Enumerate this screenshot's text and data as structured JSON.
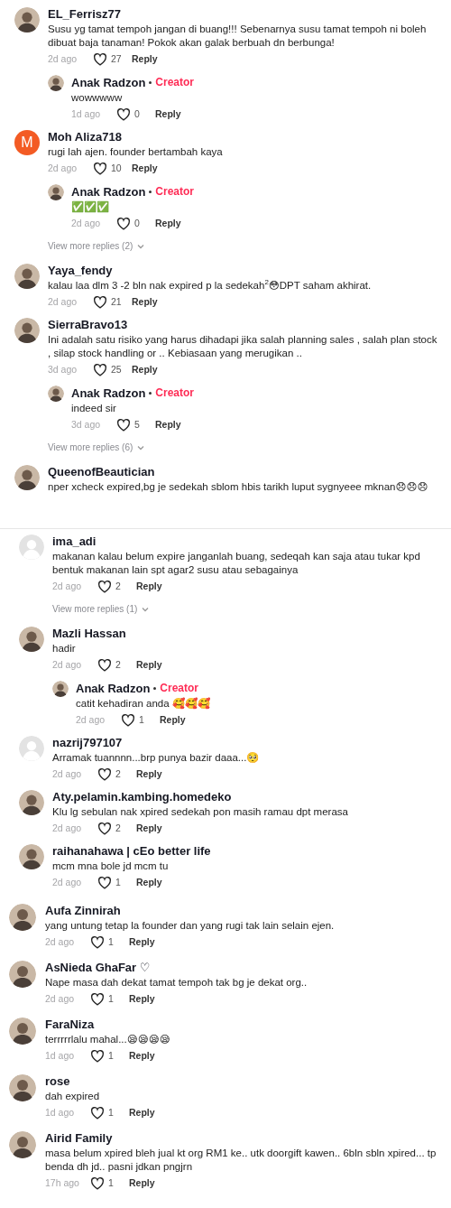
{
  "sections": [
    {
      "comments": [
        {
          "user": "EL_Ferrisz77",
          "avatar": {
            "kind": "photo"
          },
          "text": "Susu yg tamat tempoh jangan di buang!!! Sebenarnya susu tamat tempoh ni boleh dibuat baja tanaman! Pokok akan galak berbuah dn berbunga!",
          "time": "2d ago",
          "likes": "27",
          "reply": "Reply",
          "replies": [
            {
              "user": "Anak Radzon",
              "badge": "Creator",
              "avatar": {
                "kind": "photo"
              },
              "text": "wowwwww",
              "time": "1d ago",
              "likes": "0",
              "reply": "Reply"
            }
          ]
        },
        {
          "user": "Moh Aliza718",
          "avatar": {
            "kind": "letter",
            "letter": "M"
          },
          "text": "rugi lah ajen. founder bertambah kaya",
          "time": "2d ago",
          "likes": "10",
          "reply": "Reply",
          "replies": [
            {
              "user": "Anak Radzon",
              "badge": "Creator",
              "avatar": {
                "kind": "photo"
              },
              "text": "✅✅✅",
              "time": "2d ago",
              "likes": "0",
              "reply": "Reply"
            }
          ],
          "more_replies": "View more replies (2)"
        },
        {
          "user": "Yaya_fendy",
          "avatar": {
            "kind": "photo"
          },
          "text": "kalau laa dlm 3 -2 bln nak expired p la sedekah$^{2}$😳DPT saham akhirat.",
          "time": "2d ago",
          "likes": "21",
          "reply": "Reply"
        },
        {
          "user": "SierraBravo13",
          "avatar": {
            "kind": "photo"
          },
          "text": "Ini adalah satu risiko yang harus dihadapi jika salah planning sales , salah plan stock , silap stock handling or .. Kebiasaan yang merugikan ..",
          "time": "3d ago",
          "likes": "25",
          "reply": "Reply",
          "replies": [
            {
              "user": "Anak Radzon",
              "badge": "Creator",
              "avatar": {
                "kind": "photo"
              },
              "text": "indeed sir",
              "time": "3d ago",
              "likes": "5",
              "reply": "Reply"
            }
          ],
          "more_replies": "View more replies (6)"
        },
        {
          "user": "QueenofBeautician",
          "avatar": {
            "kind": "photo"
          },
          "text": "nper xcheck expired,bg je sedekah sblom hbis tarikh luput sygnyeee mknan😞😞😞"
        }
      ]
    },
    {
      "comments": [
        {
          "user": "ima_adi",
          "avatar": {
            "kind": "default"
          },
          "text": "makanan kalau belum expire janganlah buang, sedeqah kan saja atau tukar kpd bentuk makanan lain spt agar2 susu atau sebagainya",
          "time": "2d ago",
          "likes": "2",
          "reply": "Reply",
          "more_replies": "View more replies (1)"
        },
        {
          "user": "Mazli Hassan",
          "avatar": {
            "kind": "photo"
          },
          "text": "hadir",
          "time": "2d ago",
          "likes": "2",
          "reply": "Reply",
          "replies": [
            {
              "user": "Anak Radzon",
              "badge": "Creator",
              "avatar": {
                "kind": "photo"
              },
              "text": "catit kehadiran anda 🥰🥰🥰",
              "time": "2d ago",
              "likes": "1",
              "reply": "Reply"
            }
          ]
        },
        {
          "user": "nazrij797107",
          "avatar": {
            "kind": "default"
          },
          "text": "Arramak tuannnn...brp punya bazir daaa...🥺",
          "time": "2d ago",
          "likes": "2",
          "reply": "Reply"
        },
        {
          "user": "Aty.pelamin.kambing.homedeko",
          "avatar": {
            "kind": "photo"
          },
          "text": "Klu lg sebulan nak xpired sedekah pon masih ramau dpt merasa",
          "time": "2d ago",
          "likes": "2",
          "reply": "Reply"
        },
        {
          "user": "raihanahawa | cEo better life",
          "avatar": {
            "kind": "photo"
          },
          "text": "mcm mna bole jd mcm tu",
          "time": "2d ago",
          "likes": "1",
          "reply": "Reply"
        }
      ]
    },
    {
      "comments": [
        {
          "user": "Aufa Zinnirah",
          "avatar": {
            "kind": "photo"
          },
          "text": "yang untung tetap la founder dan yang rugi tak lain selain ejen.",
          "time": "2d ago",
          "likes": "1",
          "reply": "Reply"
        },
        {
          "user": "AsNieda GhaFar ♡",
          "avatar": {
            "kind": "photo"
          },
          "text": "Nape masa dah dekat tamat tempoh tak bg je dekat org..",
          "time": "2d ago",
          "likes": "1",
          "reply": "Reply"
        },
        {
          "user": "FaraNiza",
          "avatar": {
            "kind": "photo"
          },
          "text": "terrrrrlalu mahal...😪😪😪😪",
          "time": "1d ago",
          "likes": "1",
          "reply": "Reply"
        },
        {
          "user": "rose",
          "avatar": {
            "kind": "photo"
          },
          "text": "dah expired",
          "time": "1d ago",
          "likes": "1",
          "reply": "Reply"
        },
        {
          "user": "Airid Family",
          "avatar": {
            "kind": "photo"
          },
          "text": "masa belum xpired bleh jual kt org RM1 ke.. utk doorgift kawen.. 6bln sbln xpired... tp benda dh jd.. pasni jdkan pngjrn",
          "time": "17h ago",
          "likes": "1",
          "reply": "Reply"
        }
      ]
    }
  ]
}
